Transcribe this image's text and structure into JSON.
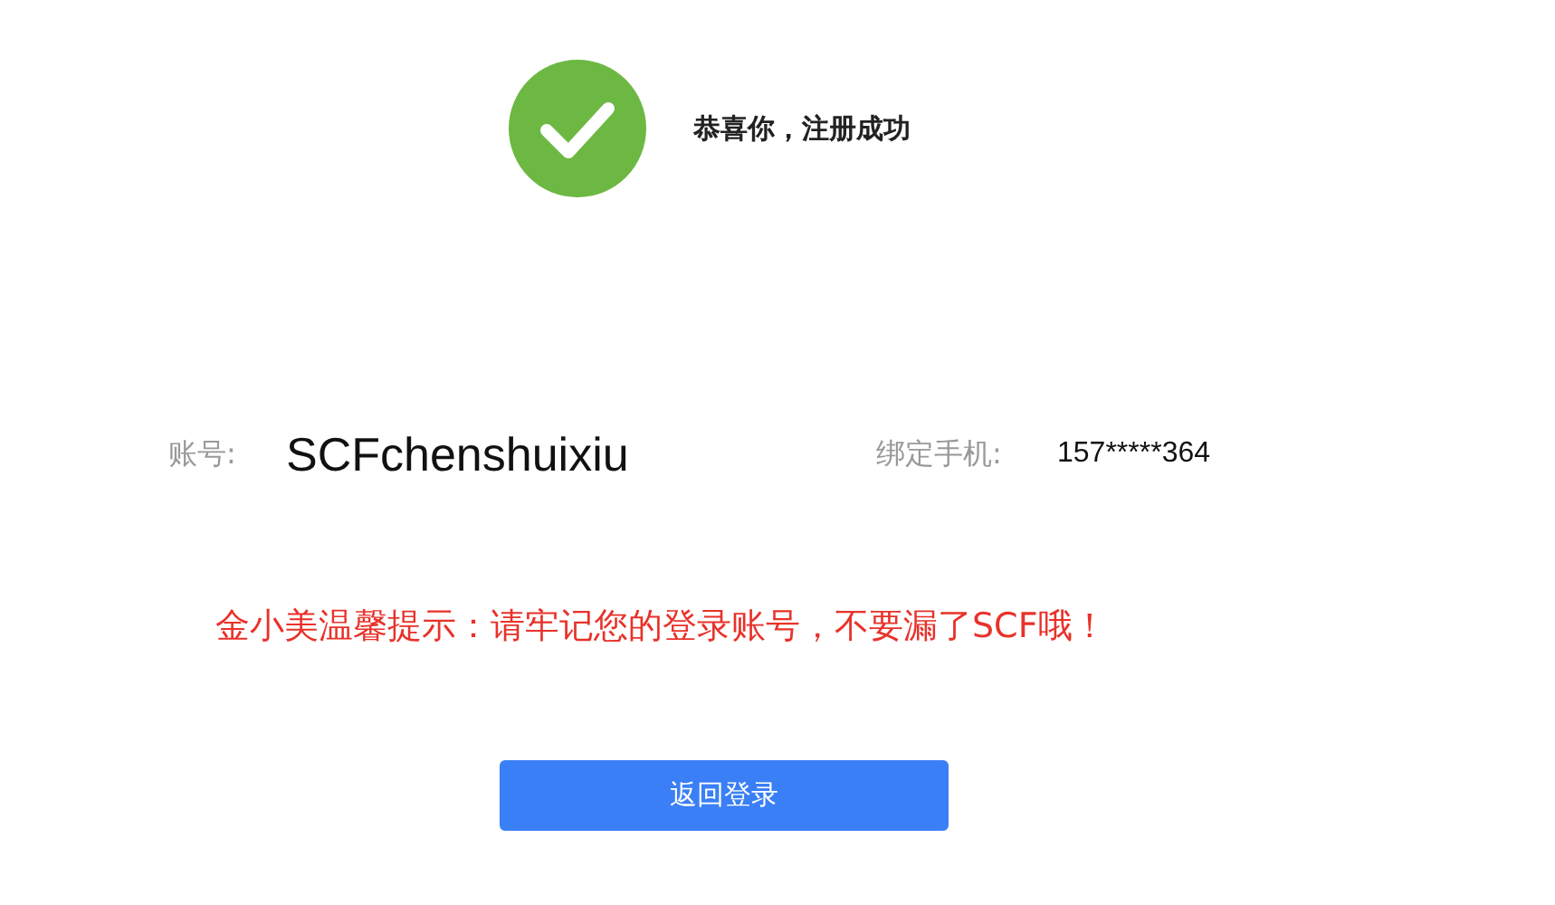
{
  "success": {
    "title": "恭喜你，注册成功"
  },
  "account": {
    "label": "账号:",
    "value": "SCFchenshuixiu"
  },
  "phone": {
    "label": "绑定手机:",
    "value": "157*****364"
  },
  "notice": "金小美温馨提示：请牢记您的登录账号，不要漏了SCF哦！",
  "button": "返回登录"
}
